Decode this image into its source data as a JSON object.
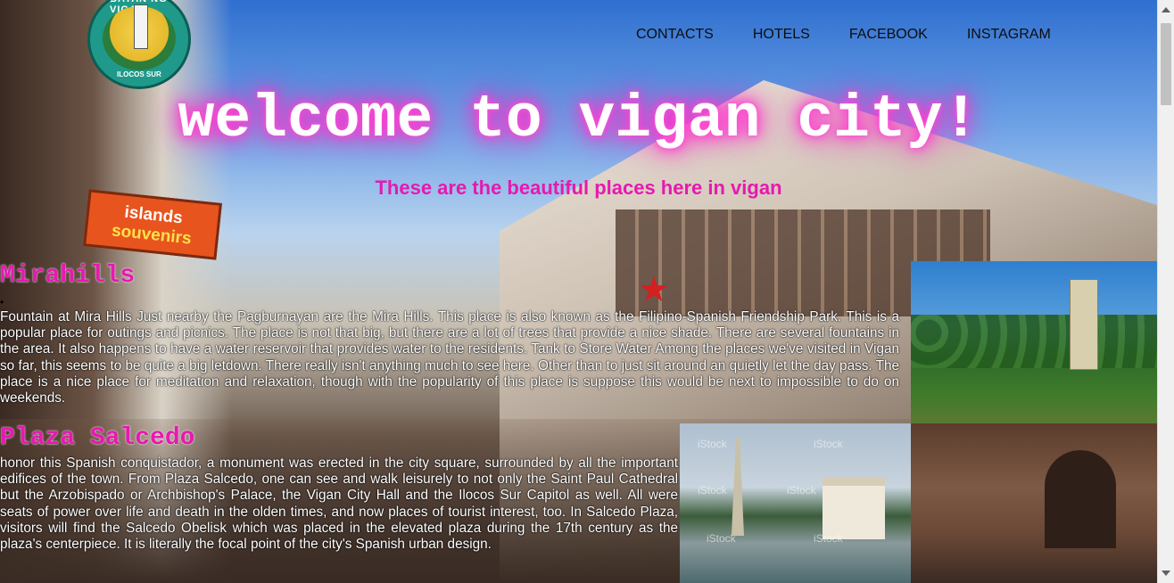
{
  "logo": {
    "top_text": "BAYAN NG VIGAN",
    "bottom_text": "ILOCOS SUR"
  },
  "nav": {
    "items": [
      "CONTACTS",
      "HOTELS",
      "FACEBOOK",
      "INSTAGRAM"
    ]
  },
  "hero": {
    "title": "welcome to vigan city!",
    "subtitle": "These are the beautiful places here in vigan"
  },
  "background_sign": {
    "line1": "islands",
    "line2": "souvenirs"
  },
  "sections": [
    {
      "title": "Mirahills",
      "bullet": "•",
      "text": "Fountain at Mira Hills Just nearby the Pagburnayan are the Mira Hills. This place is also known as the Filipino-Spanish Friendship Park. This is a popular place for outings and picnics. The place is not that big, but there are a lot of trees that provide a nice shade. There are several fountains in the area. It also happens to have a water reservoir that provides water to the residents. Tank to Store Water Among the places we've visited in Vigan so far, this seems to be quite a big letdown. There really isn't anything much to see here. Other than to just sit around an quietly let the day pass. The place is a nice place for meditation and relaxation, though with the popularity of this place is suppose this would be next to impossible to do on weekends."
    },
    {
      "title": "Plaza Salcedo",
      "text": "honor this Spanish conquistador, a monument was erected in the city square, surrounded by all the important edifices of the town. From Plaza Salcedo, one can see and walk leisurely to not only the Saint Paul Cathedral but the Arzobispado or Archbishop's Palace, the Vigan City Hall and the Ilocos Sur Capitol as well. All were seats of power over life and death in the olden times, and now places of tourist interest, too. In Salcedo Plaza, visitors will find the Salcedo Obelisk which was placed in the elevated plaza during the 17th century as the plaza's centerpiece. It is literally the focal point of the city's Spanish urban design."
    }
  ],
  "photos": {
    "watermark": "iStock"
  },
  "colors": {
    "accent": "#e619b0",
    "glow": "#ff2ac6",
    "nav_text": "#0d0d0d"
  }
}
